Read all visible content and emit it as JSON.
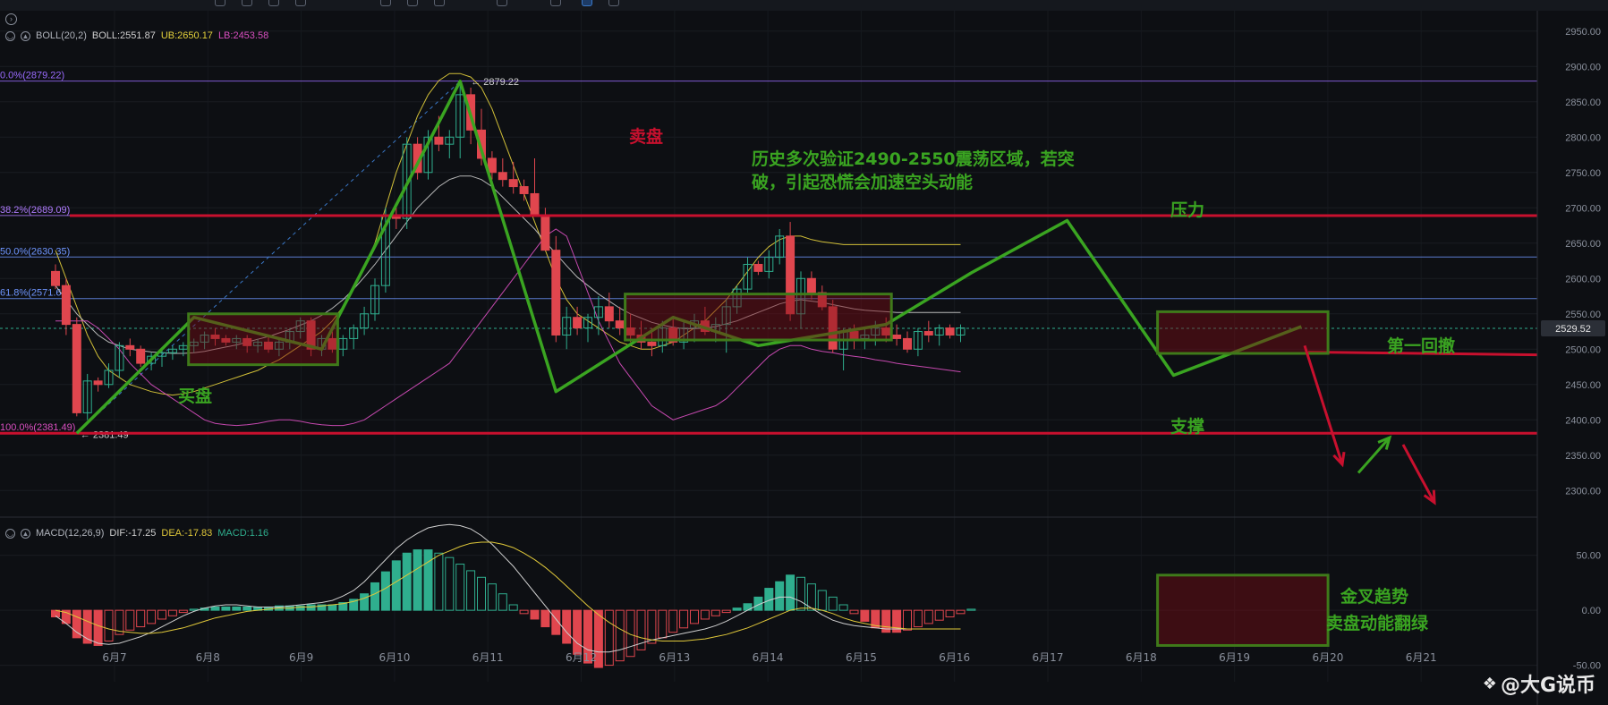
{
  "colors": {
    "up": "#2fae8e",
    "down": "#e0464e",
    "boll_mid": "#c8c8c8",
    "boll_ub": "#e5d23c",
    "boll_lb": "#d94fc0",
    "dif": "#cfcfcf",
    "dea": "#e0c83a",
    "annot_green": "#3aa421",
    "annot_red": "#c8102e",
    "fib": "#9b6bff",
    "fib_blue": "#5a8cff",
    "price_tag": "#2b2f37"
  },
  "boll_legend": {
    "label": "BOLL(20,2)",
    "mid": "BOLL:2551.87",
    "ub": "UB:2650.17",
    "lb": "LB:2453.58"
  },
  "macd_legend": {
    "label": "MACD(12,26,9)",
    "dif": "DIF:-17.25",
    "dea": "DEA:-17.83",
    "macd": "MACD:1.16"
  },
  "fib_labels": [
    "0.0%(2879.22)",
    "38.2%(2689.09)",
    "50.0%(2630.35)",
    "61.8%(2571.62)",
    "100.0%(2381.49)"
  ],
  "price_marks": {
    "high": "2879.22",
    "low": "2381.49",
    "current": "2529.52"
  },
  "annotations": {
    "buy": "买盘",
    "sell": "卖盘",
    "history_line1": "历史多次验证2490-2550震荡区域，若突",
    "history_line2": "破，引起恐慌会加速空头动能",
    "resistance": "压力",
    "support": "支撑",
    "first_pullback": "第一回撤",
    "golden_cross": "金叉趋势",
    "sell_green": "卖盘动能翻绿"
  },
  "watermark": "@大G说币",
  "chart_data": [
    {
      "type": "candlestick",
      "x_axis": {
        "ticks": [
          "6月7",
          "6月8",
          "6月9",
          "6月10",
          "6月11",
          "6月12",
          "6月13",
          "6月14",
          "6月15",
          "6月16",
          "6月17",
          "6月18",
          "6月19",
          "6月20",
          "6月21"
        ]
      },
      "y_axis": {
        "ticks": [
          2950,
          2900,
          2850,
          2800,
          2750,
          2700,
          2650,
          2600,
          2550,
          2500,
          2450,
          2400,
          2350,
          2300
        ],
        "range": [
          2270,
          2975
        ]
      },
      "candles": [
        [
          2610,
          2620,
          2585,
          2590
        ],
        [
          2590,
          2600,
          2520,
          2535
        ],
        [
          2535,
          2545,
          2405,
          2410
        ],
        [
          2410,
          2465,
          2400,
          2455
        ],
        [
          2455,
          2460,
          2440,
          2450
        ],
        [
          2450,
          2480,
          2445,
          2470
        ],
        [
          2470,
          2510,
          2460,
          2505
        ],
        [
          2505,
          2515,
          2490,
          2500
        ],
        [
          2500,
          2505,
          2475,
          2480
        ],
        [
          2480,
          2495,
          2470,
          2490
        ],
        [
          2490,
          2500,
          2475,
          2495
        ],
        [
          2495,
          2505,
          2485,
          2500
        ],
        [
          2500,
          2510,
          2490,
          2505
        ],
        [
          2505,
          2515,
          2495,
          2510
        ],
        [
          2510,
          2525,
          2500,
          2520
        ],
        [
          2520,
          2530,
          2505,
          2515
        ],
        [
          2515,
          2520,
          2505,
          2510
        ],
        [
          2510,
          2520,
          2500,
          2515
        ],
        [
          2515,
          2520,
          2495,
          2505
        ],
        [
          2505,
          2515,
          2495,
          2510
        ],
        [
          2510,
          2520,
          2495,
          2500
        ],
        [
          2500,
          2515,
          2490,
          2510
        ],
        [
          2510,
          2530,
          2500,
          2525
        ],
        [
          2525,
          2545,
          2515,
          2540
        ],
        [
          2540,
          2545,
          2490,
          2500
        ],
        [
          2500,
          2520,
          2490,
          2515
        ],
        [
          2515,
          2525,
          2495,
          2500
        ],
        [
          2500,
          2520,
          2490,
          2515
        ],
        [
          2515,
          2535,
          2500,
          2530
        ],
        [
          2530,
          2560,
          2520,
          2550
        ],
        [
          2550,
          2600,
          2540,
          2590
        ],
        [
          2590,
          2700,
          2580,
          2690
        ],
        [
          2690,
          2700,
          2670,
          2685
        ],
        [
          2685,
          2800,
          2670,
          2790
        ],
        [
          2790,
          2800,
          2740,
          2750
        ],
        [
          2750,
          2810,
          2740,
          2800
        ],
        [
          2800,
          2830,
          2780,
          2790
        ],
        [
          2790,
          2810,
          2770,
          2800
        ],
        [
          2800,
          2880,
          2770,
          2860
        ],
        [
          2860,
          2870,
          2790,
          2810
        ],
        [
          2810,
          2840,
          2760,
          2770
        ],
        [
          2770,
          2780,
          2740,
          2750
        ],
        [
          2750,
          2770,
          2730,
          2740
        ],
        [
          2740,
          2765,
          2720,
          2730
        ],
        [
          2730,
          2740,
          2710,
          2720
        ],
        [
          2720,
          2770,
          2690,
          2690
        ],
        [
          2690,
          2700,
          2640,
          2640
        ],
        [
          2640,
          2660,
          2510,
          2520
        ],
        [
          2520,
          2560,
          2500,
          2545
        ],
        [
          2545,
          2560,
          2520,
          2530
        ],
        [
          2530,
          2550,
          2510,
          2545
        ],
        [
          2545,
          2575,
          2520,
          2560
        ],
        [
          2560,
          2580,
          2530,
          2540
        ],
        [
          2540,
          2560,
          2520,
          2530
        ],
        [
          2530,
          2550,
          2510,
          2520
        ],
        [
          2520,
          2540,
          2500,
          2510
        ],
        [
          2510,
          2530,
          2490,
          2505
        ],
        [
          2505,
          2540,
          2495,
          2530
        ],
        [
          2530,
          2545,
          2505,
          2510
        ],
        [
          2510,
          2540,
          2500,
          2530
        ],
        [
          2530,
          2550,
          2510,
          2540
        ],
        [
          2540,
          2560,
          2520,
          2525
        ],
        [
          2525,
          2545,
          2510,
          2535
        ],
        [
          2535,
          2570,
          2495,
          2560
        ],
        [
          2560,
          2590,
          2550,
          2585
        ],
        [
          2585,
          2630,
          2580,
          2620
        ],
        [
          2620,
          2625,
          2605,
          2610
        ],
        [
          2610,
          2640,
          2600,
          2630
        ],
        [
          2630,
          2670,
          2620,
          2660
        ],
        [
          2660,
          2680,
          2540,
          2550
        ],
        [
          2550,
          2610,
          2530,
          2600
        ],
        [
          2600,
          2610,
          2570,
          2580
        ],
        [
          2580,
          2590,
          2555,
          2560
        ],
        [
          2560,
          2570,
          2495,
          2500
        ],
        [
          2500,
          2530,
          2470,
          2525
        ],
        [
          2525,
          2535,
          2500,
          2515
        ],
        [
          2515,
          2530,
          2500,
          2520
        ],
        [
          2520,
          2540,
          2505,
          2530
        ],
        [
          2530,
          2545,
          2510,
          2520
        ],
        [
          2520,
          2535,
          2505,
          2515
        ],
        [
          2515,
          2525,
          2495,
          2500
        ],
        [
          2500,
          2530,
          2490,
          2525
        ],
        [
          2525,
          2540,
          2510,
          2520
        ],
        [
          2520,
          2535,
          2505,
          2530
        ],
        [
          2530,
          2535,
          2515,
          2520
        ],
        [
          2520,
          2535,
          2510,
          2530
        ]
      ],
      "boll_series": [
        {
          "values": [
            2640,
            2600,
            2560,
            2520,
            2490,
            2470,
            2460,
            2450,
            2445,
            2440,
            2437,
            2435,
            2437,
            2440,
            2445,
            2450,
            2455,
            2460,
            2465,
            2470,
            2478,
            2485,
            2495,
            2505,
            2515,
            2525,
            2540,
            2560,
            2585,
            2615,
            2650,
            2700,
            2750,
            2790,
            2830,
            2860,
            2880,
            2890,
            2890,
            2885,
            2870,
            2840,
            2800,
            2760,
            2720,
            2680,
            2640,
            2600,
            2570,
            2550,
            2540,
            2530,
            2520,
            2510,
            2505,
            2500,
            2500,
            2505,
            2510,
            2520,
            2530,
            2540,
            2555,
            2570,
            2590,
            2610,
            2630,
            2645,
            2655,
            2660,
            2660,
            2655,
            2652,
            2650,
            2648,
            2648,
            2648,
            2648,
            2648,
            2648,
            2648,
            2648,
            2648,
            2648,
            2648,
            2648
          ]
        },
        {
          "values": [
            2590,
            2570,
            2550,
            2535,
            2520,
            2510,
            2505,
            2500,
            2498,
            2496,
            2495,
            2494,
            2494,
            2495,
            2497,
            2500,
            2503,
            2506,
            2510,
            2514,
            2518,
            2523,
            2528,
            2534,
            2540,
            2548,
            2558,
            2570,
            2585,
            2602,
            2620,
            2640,
            2660,
            2680,
            2700,
            2715,
            2730,
            2740,
            2745,
            2745,
            2740,
            2730,
            2715,
            2700,
            2685,
            2670,
            2652,
            2635,
            2618,
            2602,
            2590,
            2578,
            2568,
            2558,
            2550,
            2544,
            2538,
            2534,
            2531,
            2529,
            2529,
            2530,
            2532,
            2536,
            2540,
            2546,
            2552,
            2558,
            2564,
            2568,
            2570,
            2568,
            2566,
            2563,
            2560,
            2557,
            2555,
            2554,
            2553,
            2552,
            2552,
            2552,
            2552,
            2552,
            2552,
            2552
          ]
        },
        {
          "values": [
            2540,
            2540,
            2540,
            2540,
            2530,
            2515,
            2500,
            2480,
            2465,
            2450,
            2440,
            2430,
            2420,
            2410,
            2400,
            2395,
            2393,
            2392,
            2393,
            2395,
            2398,
            2400,
            2400,
            2398,
            2395,
            2393,
            2392,
            2392,
            2395,
            2400,
            2410,
            2420,
            2430,
            2440,
            2450,
            2460,
            2470,
            2480,
            2500,
            2520,
            2540,
            2560,
            2580,
            2600,
            2620,
            2640,
            2660,
            2670,
            2660,
            2620,
            2580,
            2540,
            2510,
            2480,
            2460,
            2440,
            2420,
            2410,
            2400,
            2405,
            2410,
            2415,
            2420,
            2430,
            2445,
            2460,
            2475,
            2490,
            2500,
            2505,
            2505,
            2500,
            2497,
            2495,
            2492,
            2490,
            2488,
            2485,
            2483,
            2480,
            2478,
            2476,
            2474,
            2472,
            2470,
            2468
          ]
        }
      ],
      "fib_levels": [
        {
          "label": "0.0%",
          "value": 2879.22
        },
        {
          "label": "38.2%",
          "value": 2689.09
        },
        {
          "label": "50.0%",
          "value": 2630.35
        },
        {
          "label": "61.8%",
          "value": 2571.62
        },
        {
          "label": "100.0%",
          "value": 2381.49
        }
      ],
      "resistance": 2689,
      "support": 2381,
      "current": 2529.52
    },
    {
      "type": "bar",
      "y_axis": {
        "ticks": [
          50,
          0,
          -50
        ],
        "range": [
          -65,
          75
        ]
      },
      "histogram": [
        -6,
        -12,
        -25,
        -30,
        -32,
        -28,
        -22,
        -18,
        -15,
        -12,
        -8,
        -5,
        -2,
        1,
        2,
        3,
        3,
        3,
        3,
        3,
        3,
        4,
        4,
        4,
        5,
        5,
        5,
        7,
        10,
        15,
        25,
        35,
        45,
        52,
        55,
        55,
        52,
        48,
        42,
        36,
        30,
        24,
        15,
        5,
        -3,
        -8,
        -15,
        -22,
        -30,
        -40,
        -48,
        -52,
        -50,
        -46,
        -42,
        -36,
        -30,
        -25,
        -20,
        -16,
        -12,
        -8,
        -5,
        -2,
        2,
        6,
        12,
        20,
        26,
        32,
        30,
        24,
        18,
        12,
        5,
        -3,
        -10,
        -16,
        -20,
        -20,
        -18,
        -15,
        -12,
        -9,
        -6,
        -3,
        1
      ],
      "dif": [
        -5,
        -12,
        -20,
        -26,
        -30,
        -31,
        -30,
        -27,
        -24,
        -20,
        -15,
        -10,
        -5,
        -1,
        2,
        4,
        5,
        5,
        4,
        3,
        3,
        3,
        4,
        5,
        6,
        7,
        9,
        13,
        18,
        26,
        36,
        46,
        56,
        64,
        70,
        75,
        77,
        78,
        77,
        74,
        68,
        60,
        50,
        40,
        28,
        16,
        4,
        -8,
        -20,
        -30,
        -36,
        -38,
        -38,
        -36,
        -33,
        -30,
        -27,
        -25,
        -23,
        -21,
        -19,
        -17,
        -14,
        -10,
        -5,
        0,
        5,
        9,
        12,
        12,
        8,
        2,
        -4,
        -9,
        -12,
        -14,
        -15,
        -16,
        -17,
        -17,
        -17,
        -17,
        -17,
        -17,
        -17
      ],
      "dea": [
        0,
        -2,
        -6,
        -10,
        -14,
        -17,
        -19,
        -20,
        -21,
        -21,
        -20,
        -18,
        -16,
        -13,
        -10,
        -7,
        -5,
        -3,
        -1,
        0,
        1,
        2,
        2,
        3,
        3,
        4,
        5,
        6,
        8,
        11,
        15,
        20,
        26,
        32,
        38,
        44,
        50,
        54,
        58,
        61,
        62,
        62,
        60,
        57,
        52,
        46,
        39,
        31,
        22,
        13,
        4,
        -4,
        -11,
        -17,
        -22,
        -25,
        -27,
        -28,
        -28,
        -28,
        -27,
        -26,
        -24,
        -22,
        -19,
        -16,
        -12,
        -8,
        -4,
        0,
        2,
        2,
        0,
        -3,
        -7,
        -10,
        -12,
        -14,
        -15,
        -16,
        -17,
        -17,
        -17,
        -17,
        -17,
        -17
      ]
    }
  ]
}
